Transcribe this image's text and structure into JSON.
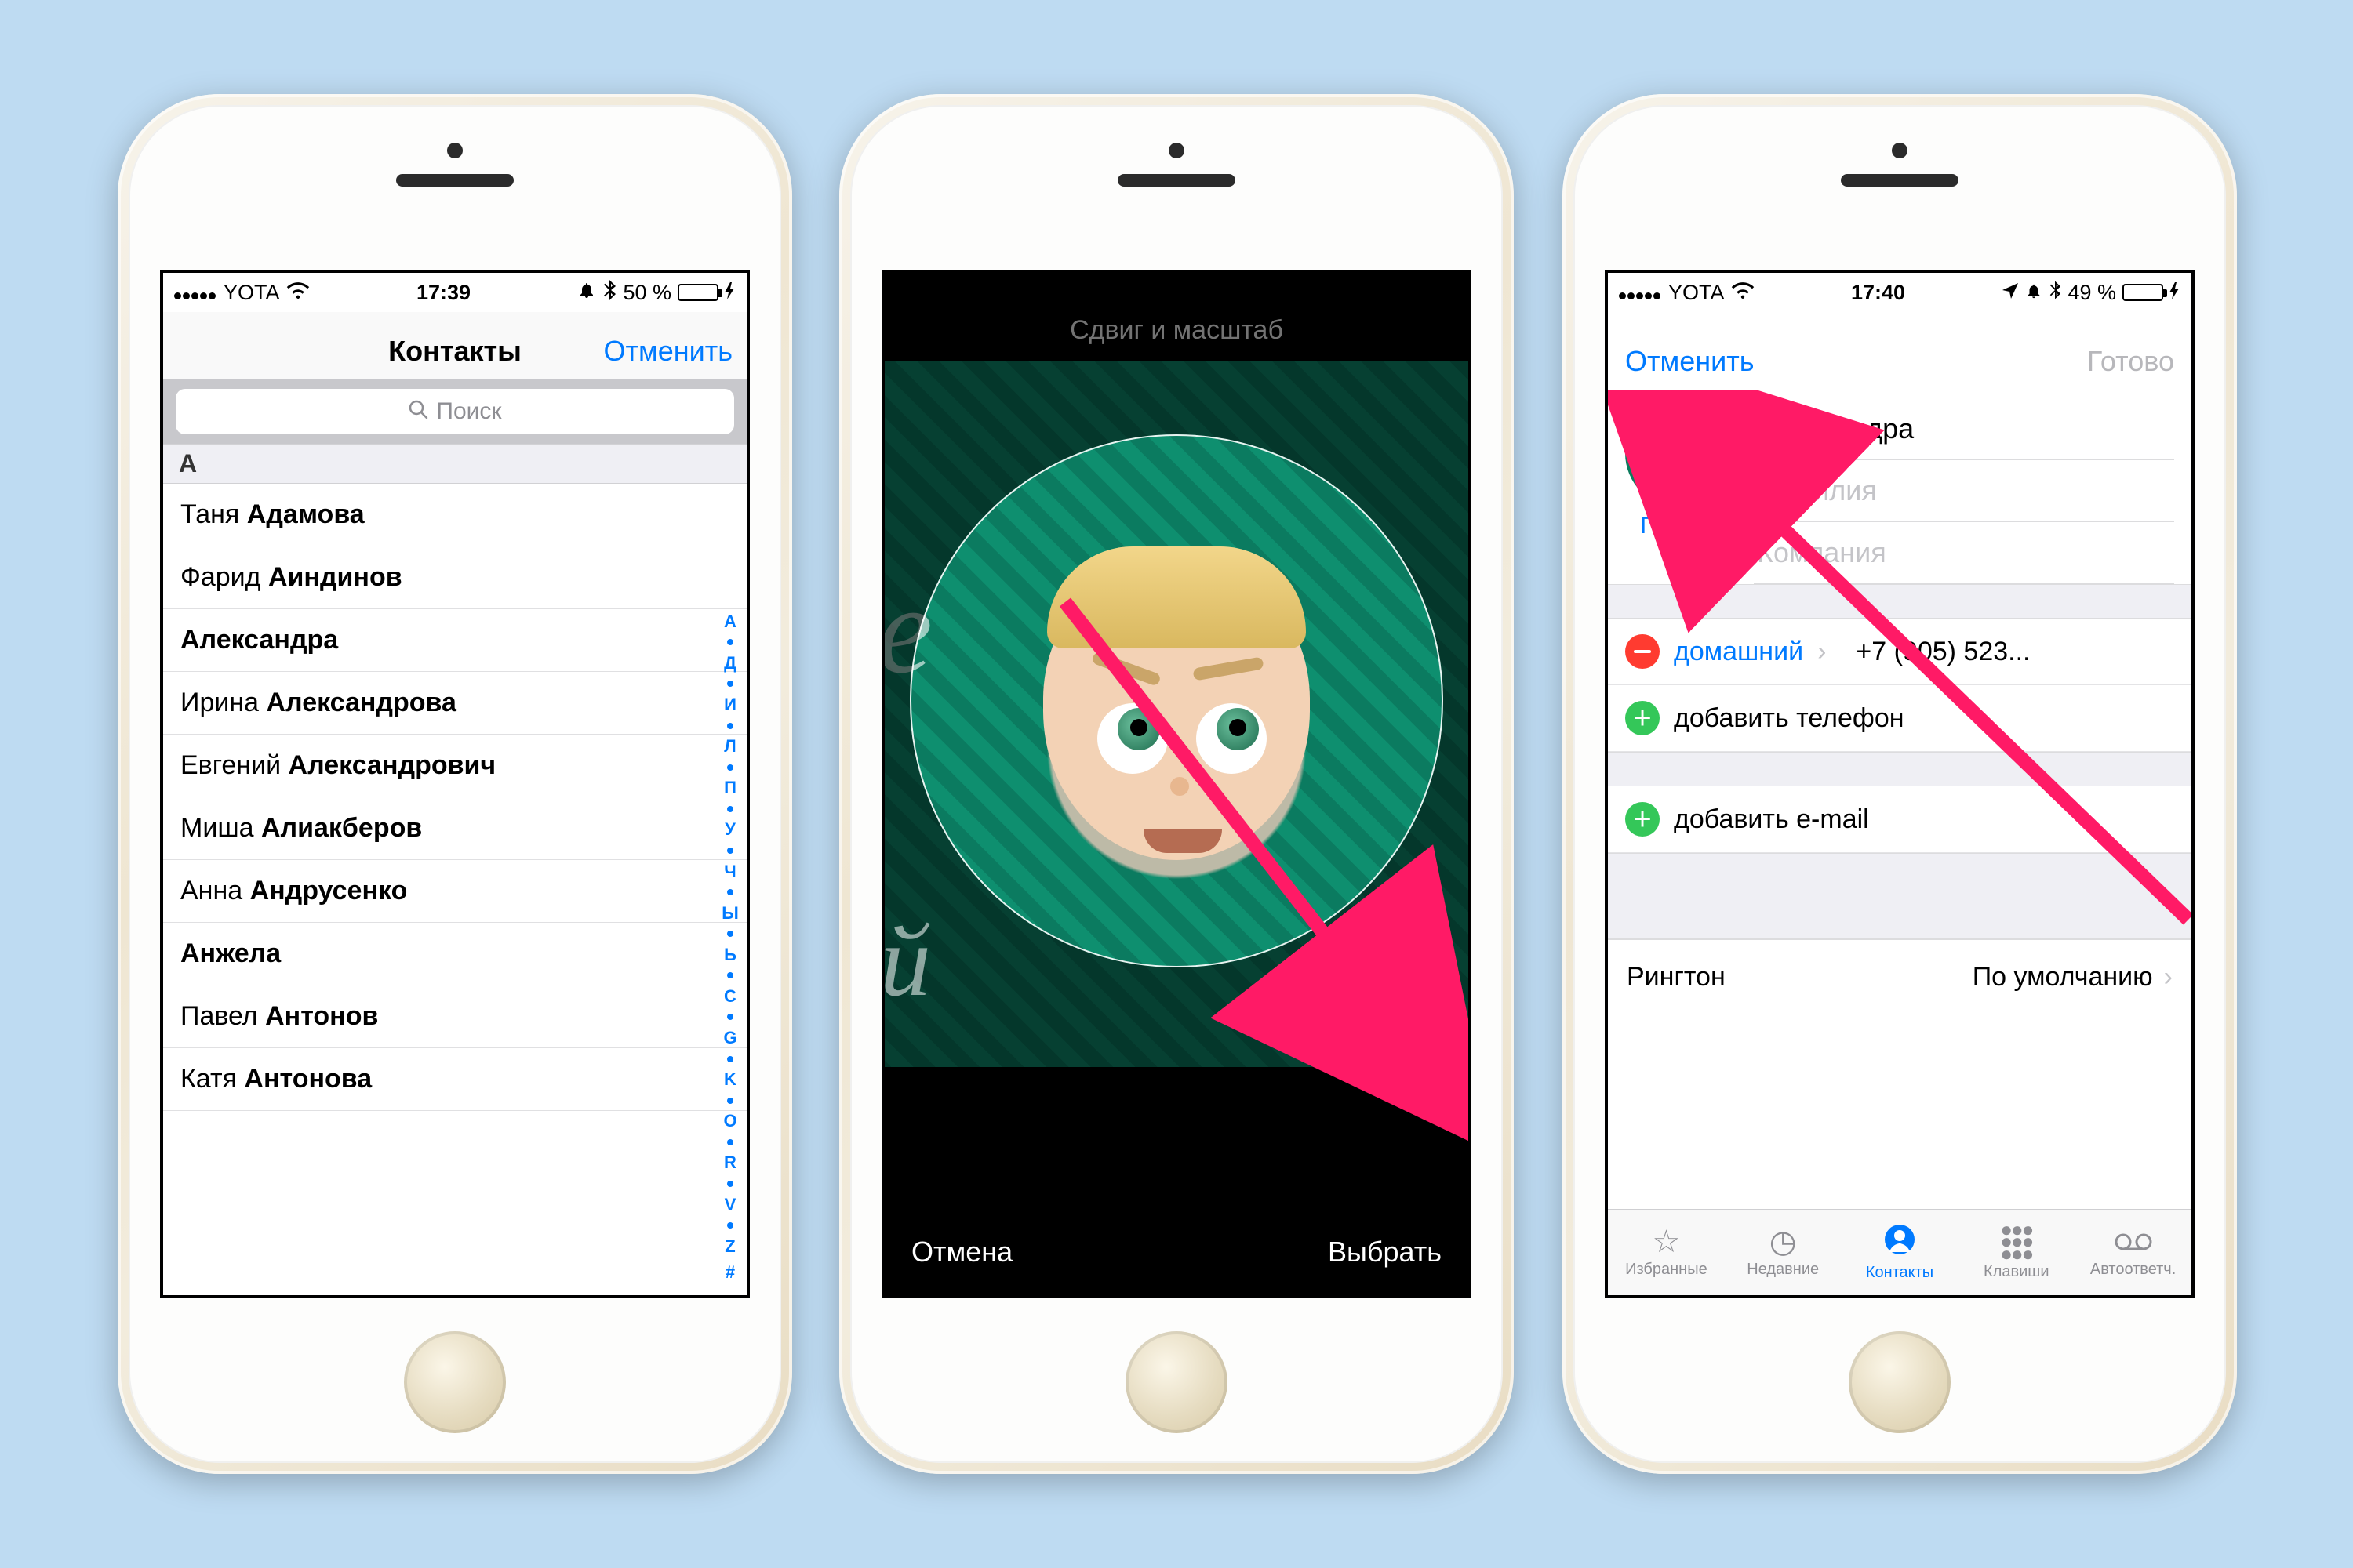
{
  "phone1": {
    "status": {
      "carrier": "YOTA",
      "time": "17:39",
      "battery_pct": "50 %"
    },
    "nav": {
      "title": "Контакты",
      "cancel": "Отменить"
    },
    "search_placeholder": "Поиск",
    "section": "А",
    "index_letters": [
      "А",
      "Д",
      "И",
      "Л",
      "П",
      "У",
      "Ч",
      "Ы",
      "Ь",
      "C",
      "G",
      "K",
      "O",
      "R",
      "V",
      "Z",
      "#"
    ],
    "contacts": [
      {
        "first": "Таня",
        "last": "Адамова"
      },
      {
        "first": "Фарид",
        "last": "Аиндинов"
      },
      {
        "first": "",
        "last": "Александра"
      },
      {
        "first": "Ирина",
        "last": "Александрова"
      },
      {
        "first": "Евгений",
        "last": "Александрович"
      },
      {
        "first": "Миша",
        "last": "Алиакберов"
      },
      {
        "first": "Анна",
        "last": "Андрусенко"
      },
      {
        "first": "",
        "last": "Анжела"
      },
      {
        "first": "Павел",
        "last": "Антонов"
      },
      {
        "first": "Катя",
        "last": "Антонова"
      }
    ]
  },
  "phone2": {
    "title": "Сдвиг и масштаб",
    "cancel": "Отмена",
    "choose": "Выбрать"
  },
  "phone3": {
    "status": {
      "carrier": "YOTA",
      "time": "17:40",
      "battery_pct": "49 %"
    },
    "nav": {
      "cancel": "Отменить",
      "done": "Готово"
    },
    "edit_photo": "Правка",
    "name": "Александра",
    "surname_ph": "Фамилия",
    "company_ph": "Компания",
    "phone_type": "домашний",
    "phone_value": "+7 (905) 523...",
    "add_phone": "добавить телефон",
    "add_email": "добавить e-mail",
    "ringtone_label": "Рингтон",
    "ringtone_value": "По умолчанию",
    "tabs": [
      {
        "icon": "☆",
        "label": "Избранные"
      },
      {
        "icon": "◷",
        "label": "Недавние"
      },
      {
        "icon": "◉",
        "label": "Контакты"
      },
      {
        "icon": "⋮⋮⋮",
        "label": "Клавиши"
      },
      {
        "icon": "◯◯",
        "label": "Автоответч."
      }
    ]
  }
}
